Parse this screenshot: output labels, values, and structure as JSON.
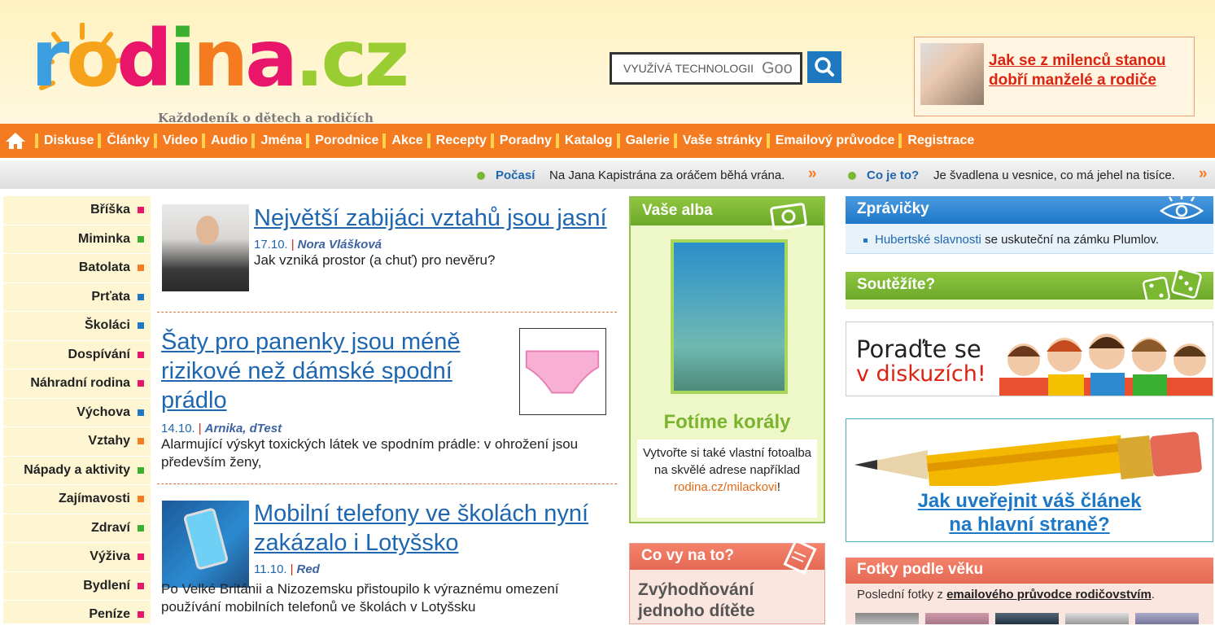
{
  "logo": {
    "word": "rodina.cz",
    "tagline": "Každodeník o dětech a rodičích"
  },
  "search": {
    "placeholder": "VYUŽÍVÁ TECHNOLOGII",
    "brand": "Goo"
  },
  "promo": {
    "title": "Jak se z milenců stanou dobří manželé a rodiče"
  },
  "nav": [
    "Diskuse",
    "Články",
    "Video",
    "Audio",
    "Jména",
    "Porodnice",
    "Akce",
    "Recepty",
    "Poradny",
    "Katalog",
    "Galerie",
    "Vaše stránky",
    "Emailový průvodce",
    "Registrace"
  ],
  "ticker": {
    "weather_label": "Počasí",
    "weather_text": "Na Jana Kapistrána za oráčem běhá vrána.",
    "what_label": "Co je to?",
    "what_text": "Je švadlena u vesnice, co má jehel na tisíce.",
    "arrow": "»"
  },
  "sidebar": [
    {
      "label": "Bříška",
      "color": "#e8156a"
    },
    {
      "label": "Miminka",
      "color": "#3ab030"
    },
    {
      "label": "Batolata",
      "color": "#f47b20"
    },
    {
      "label": "Prťata",
      "color": "#1e78c8"
    },
    {
      "label": "Školáci",
      "color": "#1e78c8"
    },
    {
      "label": "Dospívání",
      "color": "#e8156a"
    },
    {
      "label": "Náhradní rodina",
      "color": "#e8156a"
    },
    {
      "label": "Výchova",
      "color": "#1e78c8"
    },
    {
      "label": "Vztahy",
      "color": "#f47b20"
    },
    {
      "label": "Nápady a aktivity",
      "color": "#3ab030"
    },
    {
      "label": "Zajímavosti",
      "color": "#f47b20"
    },
    {
      "label": "Zdraví",
      "color": "#3ab030"
    },
    {
      "label": "Výživa",
      "color": "#e8156a"
    },
    {
      "label": "Bydlení",
      "color": "#e8156a"
    },
    {
      "label": "Peníze",
      "color": "#e8156a"
    }
  ],
  "articles": [
    {
      "title": "Největší zabijáci vztahů jsou jasní",
      "date": "17.10.",
      "author": "Nora Vlášková",
      "perex": "Jak vzniká prostor (a chuť) pro nevěru?"
    },
    {
      "title": "Šaty pro panenky jsou méně rizikové než dámské spodní prádlo",
      "date": "14.10.",
      "author": "Arnika, dTest",
      "perex": "Alarmující výskyt toxických látek ve spodním prádle: v ohrožení jsou především ženy,"
    },
    {
      "title": "Mobilní telefony ve školách nyní zakázalo i Lotyšsko",
      "date": "11.10.",
      "author": "Red",
      "perex": "Po Velké Británii a Nizozemsku přistoupilo k výraznému omezení používání mobilních telefonů ve školách v Lotyšsku"
    }
  ],
  "albums": {
    "heading": "Vaše alba",
    "photo_title": "Fotíme korály",
    "text": "Vytvořte si také vlastní fotoalba na skvělé adrese například",
    "link": "rodina.cz/milackovi",
    "after": "!"
  },
  "poll": {
    "heading": "Co vy na to?",
    "text": "Zvýhodňování jednoho dítěte"
  },
  "news": {
    "heading": "Zprávičky",
    "link": "Hubertské slavnosti",
    "rest": " se uskuteční na zámku Plumlov."
  },
  "contest": {
    "heading": "Soutěžíte?"
  },
  "discuss_banner": {
    "line1": "Poraďte se",
    "line2": "v diskuzích!"
  },
  "publish": {
    "line1": "Jak uveřejnit váš článek",
    "line2": "na hlavní straně?"
  },
  "photos_by_age": {
    "heading": "Fotky podle věku",
    "text": "Poslední fotky z ",
    "link": "emailového průvodce rodičovstvím",
    "after": "."
  }
}
